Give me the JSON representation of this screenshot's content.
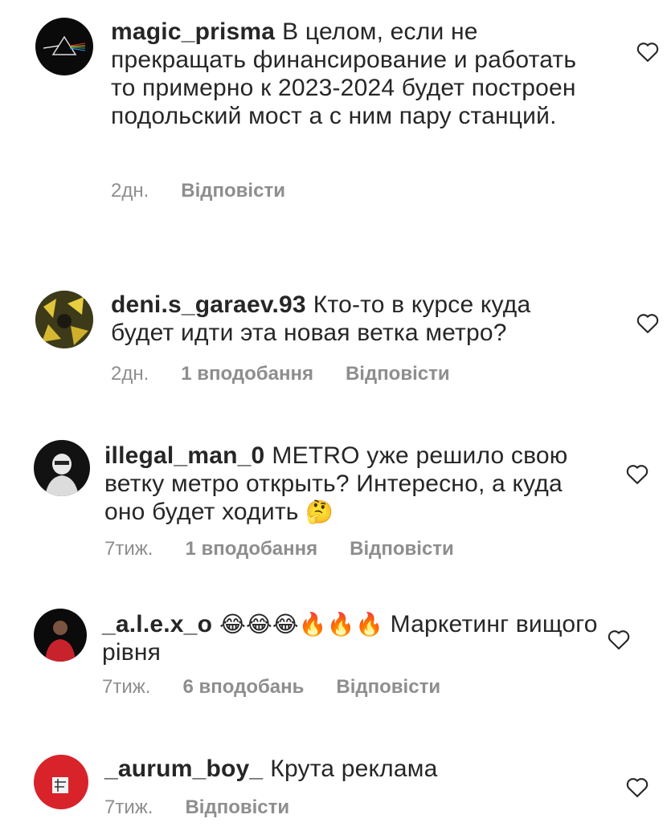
{
  "comments": [
    {
      "username": "magic_prisma",
      "text": "В целом, если не прекращать финансирование и работать то примерно к 2023-2024 будет построен подольский мост а с ним пару станций.",
      "time": "2дн.",
      "likes": "",
      "reply": "Відповісти"
    },
    {
      "username": "deni.s_garaev.93",
      "text": "Кто-то в курсе куда будет идти эта новая ветка метро?",
      "time": "2дн.",
      "likes": "1 вподобання",
      "reply": "Відповісти"
    },
    {
      "username": "illegal_man_0",
      "text": "METRO уже решило свою ветку метро открыть? Интересно, а куда оно будет ходить",
      "emoji": "🤔",
      "time": "7тиж.",
      "likes": "1 вподобання",
      "reply": "Відповісти"
    },
    {
      "username": "_a.l.e.x_o",
      "emoji": "😂😂😂🔥🔥🔥",
      "text": "Маркетинг вищого рівня",
      "time": "7тиж.",
      "likes": "6 вподобань",
      "reply": "Відповісти"
    },
    {
      "username": "_aurum_boy_",
      "text": "Крута реклама",
      "time": "7тиж.",
      "likes": "",
      "reply": "Відповісти"
    }
  ],
  "icons": {
    "like": "heart-outline-icon"
  },
  "colors": {
    "text": "#262626",
    "meta": "#8e8e8e"
  }
}
